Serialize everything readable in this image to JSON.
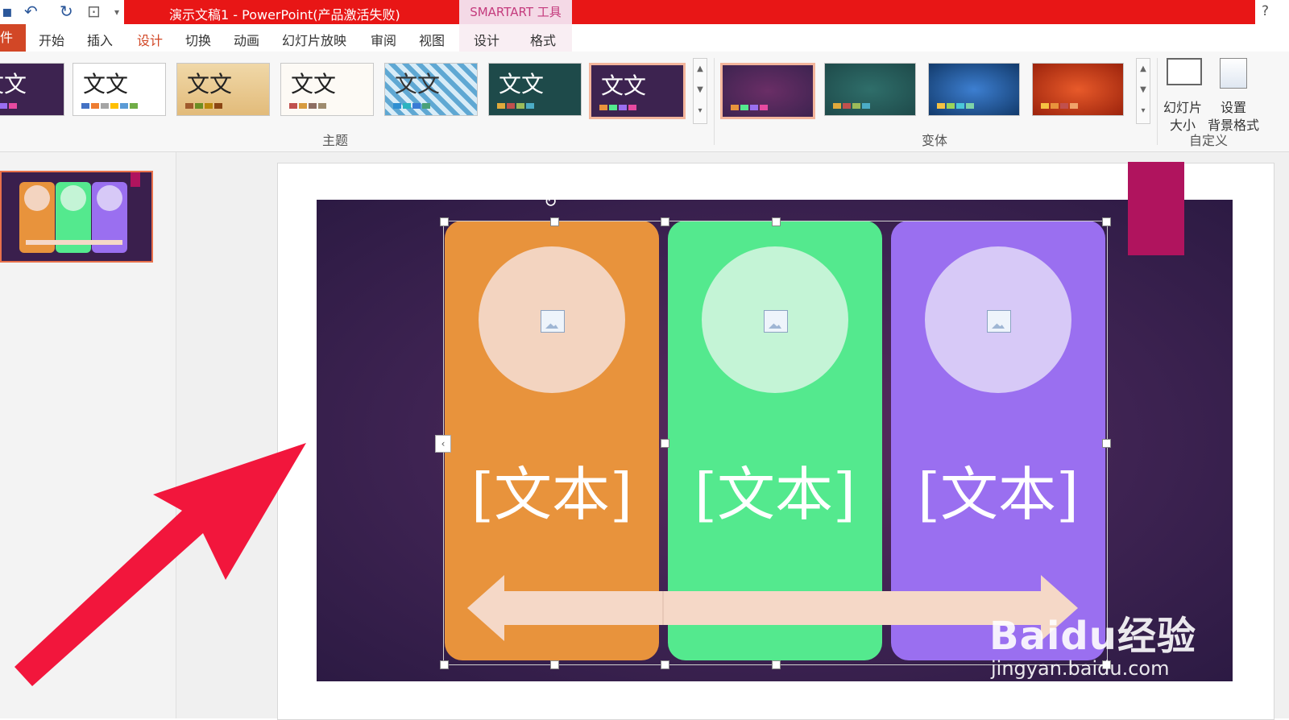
{
  "titlebar": {
    "title": "演示文稿1 -  PowerPoint(产品激活失败)",
    "context_tab": "SMARTART 工具",
    "help": "?"
  },
  "tabs": {
    "file": "件",
    "items": [
      "开始",
      "插入",
      "设计",
      "切换",
      "动画",
      "幻灯片放映",
      "审阅",
      "视图",
      "设计",
      "格式"
    ],
    "active": "设计"
  },
  "ribbon": {
    "themes_label": "主题",
    "variants_label": "变体",
    "customize_label": "自定义",
    "theme_sample_text": "文文",
    "slide_size": {
      "line1": "幻灯片",
      "line2": "大小"
    },
    "format_bg": {
      "line1": "设置",
      "line2": "背景格式"
    }
  },
  "slide": {
    "panels": [
      {
        "text": "[文本]",
        "color": "#e8933c",
        "circle": "#f3d4c0"
      },
      {
        "text": "[文本]",
        "color": "#54e98e",
        "circle": "#c4f4d6"
      },
      {
        "text": "[文本]",
        "color": "#9a6ff0",
        "circle": "#d7c9f7"
      }
    ],
    "arrow_color": "#f5d8c7",
    "background": "#3e2352",
    "accent_tag": "#b0145e"
  },
  "watermark": {
    "logo": "Baidu经验",
    "url": "jingyan.baidu.com"
  }
}
